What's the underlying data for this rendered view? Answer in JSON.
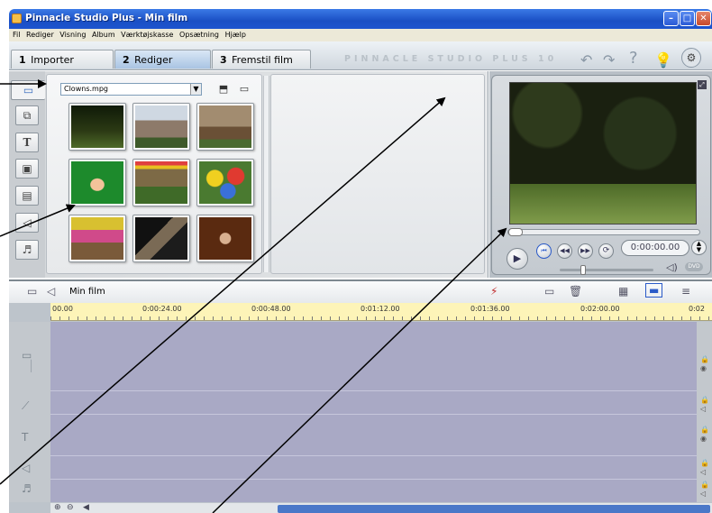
{
  "window": {
    "title": "Pinnacle Studio Plus - Min film"
  },
  "menu": [
    "Fil",
    "Rediger",
    "Visning",
    "Album",
    "Værktøjskasse",
    "Opsætning",
    "Hjælp"
  ],
  "tabs": [
    {
      "num": "1",
      "label": "Importer"
    },
    {
      "num": "2",
      "label": "Rediger"
    },
    {
      "num": "3",
      "label": "Fremstil film"
    }
  ],
  "brand": "PINNACLE STUDIO PLUS 10",
  "album": {
    "file_selected": "Clowns.mpg"
  },
  "player": {
    "timecode": "0:00:00.00",
    "dvd_label": "DVD"
  },
  "timeline": {
    "title": "Min film",
    "ticks": [
      "00.00",
      "0:00:24.00",
      "0:00:48.00",
      "0:01:12.00",
      "0:01:36.00",
      "0:02:00.00",
      "0:02"
    ]
  },
  "icons": {
    "video": "video-camera-icon",
    "transitions": "transitions-icon",
    "titles": "title-icon",
    "photos": "photo-icon",
    "menus": "disc-menu-icon",
    "sound": "sound-effects-icon",
    "music": "music-icon",
    "undo": "undo-icon",
    "redo": "redo-icon",
    "help": "help-icon",
    "tip": "lightbulb-icon",
    "render": "render-icon"
  }
}
